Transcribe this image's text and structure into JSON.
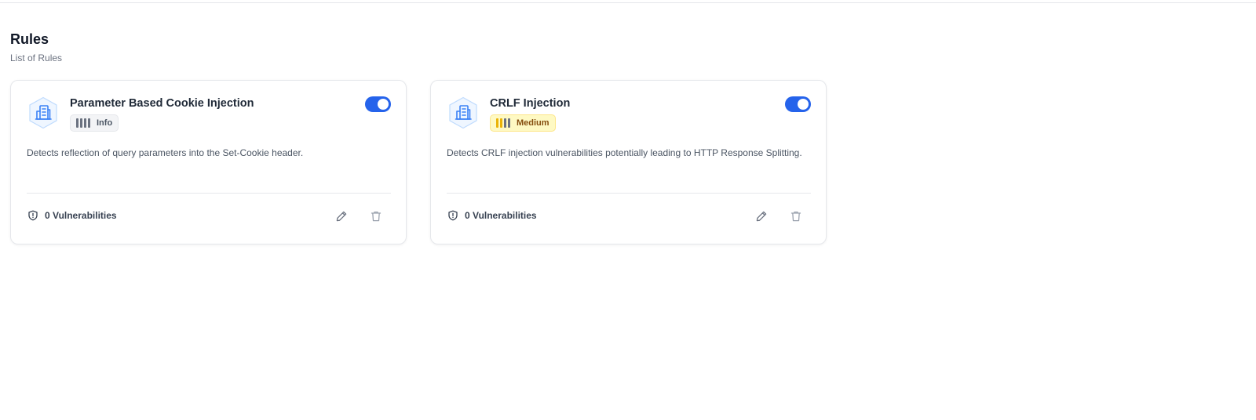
{
  "page": {
    "title": "Rules",
    "subtitle": "List of Rules"
  },
  "rules": [
    {
      "icon": "building-icon",
      "name": "Parameter Based Cookie Injection",
      "severity": "Info",
      "severity_level": 1,
      "enabled": true,
      "description": "Detects reflection of query parameters into the Set-Cookie header.",
      "vulnerabilities": "0 Vulnerabilities",
      "edit_icon": "pencil-icon",
      "delete_icon": "trash-icon"
    },
    {
      "icon": "building-icon",
      "name": "CRLF Injection",
      "severity": "Medium",
      "severity_level": 2,
      "enabled": true,
      "description": "Detects CRLF injection vulnerabilities potentially leading to HTTP Response Splitting.",
      "vulnerabilities": "0 Vulnerabilities",
      "edit_icon": "pencil-icon",
      "delete_icon": "trash-icon"
    }
  ],
  "colors": {
    "accent": "#2563eb",
    "info_bar": "#6b7280",
    "medium_bar_active": "#eab308",
    "medium_bar_inactive": "#6b7280",
    "medium_badge_bg": "#fef9c3"
  }
}
